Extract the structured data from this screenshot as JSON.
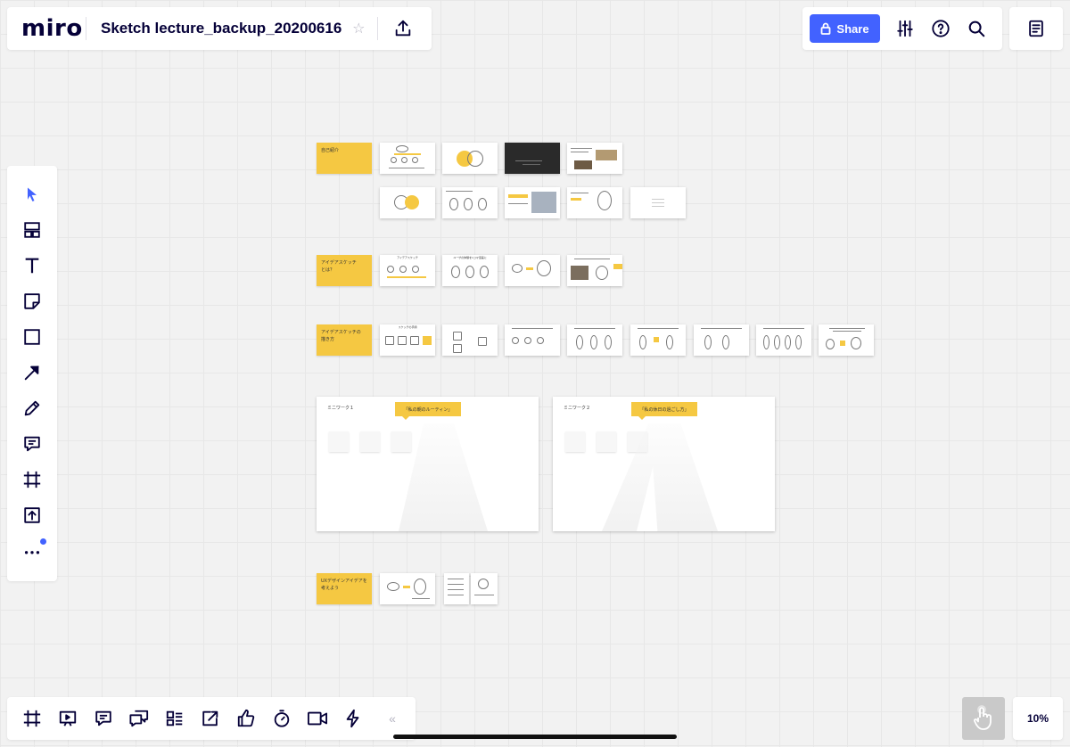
{
  "app": {
    "logo_text": "miro",
    "board_title": "Sketch lecture_backup_20200616"
  },
  "header": {
    "share_label": "Share"
  },
  "zoom": {
    "level": "10%"
  },
  "toolbar_left": [
    {
      "name": "select-tool",
      "icon": "cursor-icon"
    },
    {
      "name": "templates-tool",
      "icon": "templates-icon"
    },
    {
      "name": "text-tool",
      "icon": "text-icon"
    },
    {
      "name": "sticky-note-tool",
      "icon": "sticky-note-icon"
    },
    {
      "name": "shape-tool",
      "icon": "square-icon"
    },
    {
      "name": "connection-line-tool",
      "icon": "arrow-icon"
    },
    {
      "name": "pen-tool",
      "icon": "pen-icon"
    },
    {
      "name": "comment-tool",
      "icon": "comment-icon"
    },
    {
      "name": "frame-tool",
      "icon": "frame-icon"
    },
    {
      "name": "upload-tool",
      "icon": "upload-icon"
    },
    {
      "name": "more-tools",
      "icon": "more-icon"
    }
  ],
  "toolbar_bottom": [
    {
      "name": "frames-button",
      "icon": "frame-icon"
    },
    {
      "name": "presentation-button",
      "icon": "presentation-icon"
    },
    {
      "name": "comments-button",
      "icon": "comment-icon"
    },
    {
      "name": "chat-button",
      "icon": "chat-icon"
    },
    {
      "name": "cards-button",
      "icon": "cards-icon"
    },
    {
      "name": "share-screen-button",
      "icon": "screen-share-icon"
    },
    {
      "name": "voting-button",
      "icon": "thumbs-up-icon"
    },
    {
      "name": "timer-button",
      "icon": "timer-icon"
    },
    {
      "name": "video-chat-button",
      "icon": "video-icon"
    },
    {
      "name": "activity-button",
      "icon": "lightning-icon"
    }
  ],
  "board": {
    "sections": [
      {
        "label": "自己紹介"
      },
      {
        "label": "アイデアスケッチ\nとは？"
      },
      {
        "label": "アイデアスケッチの\n描き方"
      },
      {
        "label": "UXデザインアイデアを\n考えよう"
      }
    ],
    "frames": [
      {
        "title": "ミニワーク１",
        "tag": "「私の朝のルーティン」"
      },
      {
        "title": "ミニワーク２",
        "tag": "「私の休日の過ごし方」"
      }
    ],
    "slide_headings": {
      "r3_1": "アイデアスケッチ",
      "r3_2": "ユーザの体験を1コマ漫画に",
      "r4_1": "スケッチの手順"
    }
  },
  "colors": {
    "accent": "#4262ff",
    "sticky_yellow": "#f5c842",
    "canvas_bg": "#f2f2f2"
  }
}
